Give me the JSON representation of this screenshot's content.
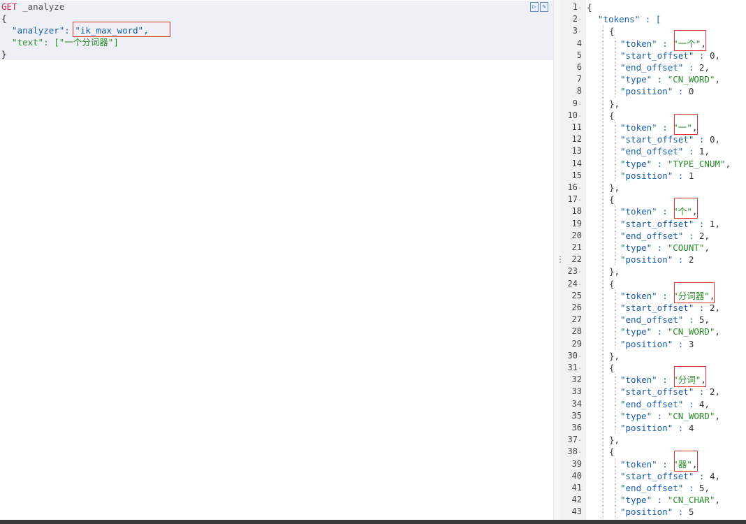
{
  "request": {
    "method": "GET",
    "path": " _analyze",
    "lines": [
      "{",
      "  \"analyzer\": \"ik_max_word\",",
      "  \"text\": [\"一个分词器\"]",
      "}"
    ]
  },
  "response": {
    "line_numbers": [
      "1",
      "2",
      "3",
      "4",
      "5",
      "6",
      "7",
      "8",
      "9",
      "10",
      "11",
      "12",
      "13",
      "14",
      "15",
      "16",
      "17",
      "18",
      "19",
      "20",
      "21",
      "22",
      "23",
      "24",
      "25",
      "26",
      "27",
      "28",
      "29",
      "30",
      "31",
      "32",
      "33",
      "34",
      "35",
      "36",
      "37",
      "38",
      "39",
      "40",
      "41",
      "42",
      "43"
    ],
    "tokens_key": "\"tokens\" : [",
    "tokens": [
      {
        "token": "一个",
        "start_offset": "0",
        "end_offset": "2",
        "type": "CN_WORD",
        "position": "0"
      },
      {
        "token": "一",
        "start_offset": "0",
        "end_offset": "1",
        "type": "TYPE_CNUM",
        "position": "1"
      },
      {
        "token": "个",
        "start_offset": "1",
        "end_offset": "2",
        "type": "COUNT",
        "position": "2"
      },
      {
        "token": "分词器",
        "start_offset": "2",
        "end_offset": "5",
        "type": "CN_WORD",
        "position": "3"
      },
      {
        "token": "分词",
        "start_offset": "2",
        "end_offset": "4",
        "type": "CN_WORD",
        "position": "4"
      },
      {
        "token": "器",
        "start_offset": "4",
        "end_offset": "5",
        "type": "CN_CHAR",
        "position": "5"
      }
    ]
  },
  "icons": {
    "run": "play-icon",
    "wrench": "wrench-icon"
  },
  "colors": {
    "highlight": "#e0342f",
    "string": "#2a8a2a",
    "key": "#1c5fa6",
    "method": "#c7254e"
  }
}
